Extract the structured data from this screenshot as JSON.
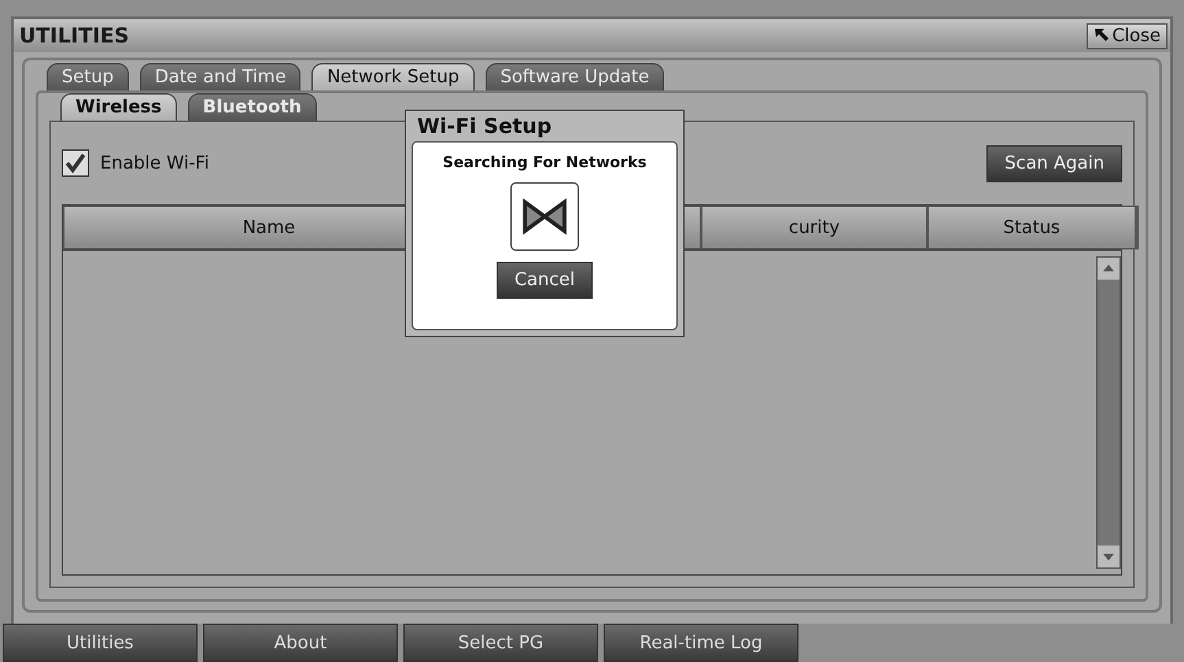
{
  "window": {
    "title": "UTILITIES",
    "close_label": "Close"
  },
  "tabs": [
    {
      "label": "Setup",
      "selected": false
    },
    {
      "label": "Date and Time",
      "selected": false
    },
    {
      "label": "Network Setup",
      "selected": true
    },
    {
      "label": "Software Update",
      "selected": false
    }
  ],
  "subtabs": [
    {
      "label": "Wireless",
      "selected": true
    },
    {
      "label": "Bluetooth",
      "selected": false
    }
  ],
  "enable_wifi": {
    "label": "Enable Wi-Fi",
    "checked": true
  },
  "scan_button": "Scan Again",
  "table": {
    "columns": [
      "Name",
      "",
      "curity",
      "Status"
    ]
  },
  "dialog": {
    "title": "Wi-Fi Setup",
    "message": "Searching For Networks",
    "button": "Cancel"
  },
  "nav": [
    {
      "label": "Utilities"
    },
    {
      "label": "About"
    },
    {
      "label": "Select PG"
    },
    {
      "label": "Real-time Log"
    }
  ]
}
